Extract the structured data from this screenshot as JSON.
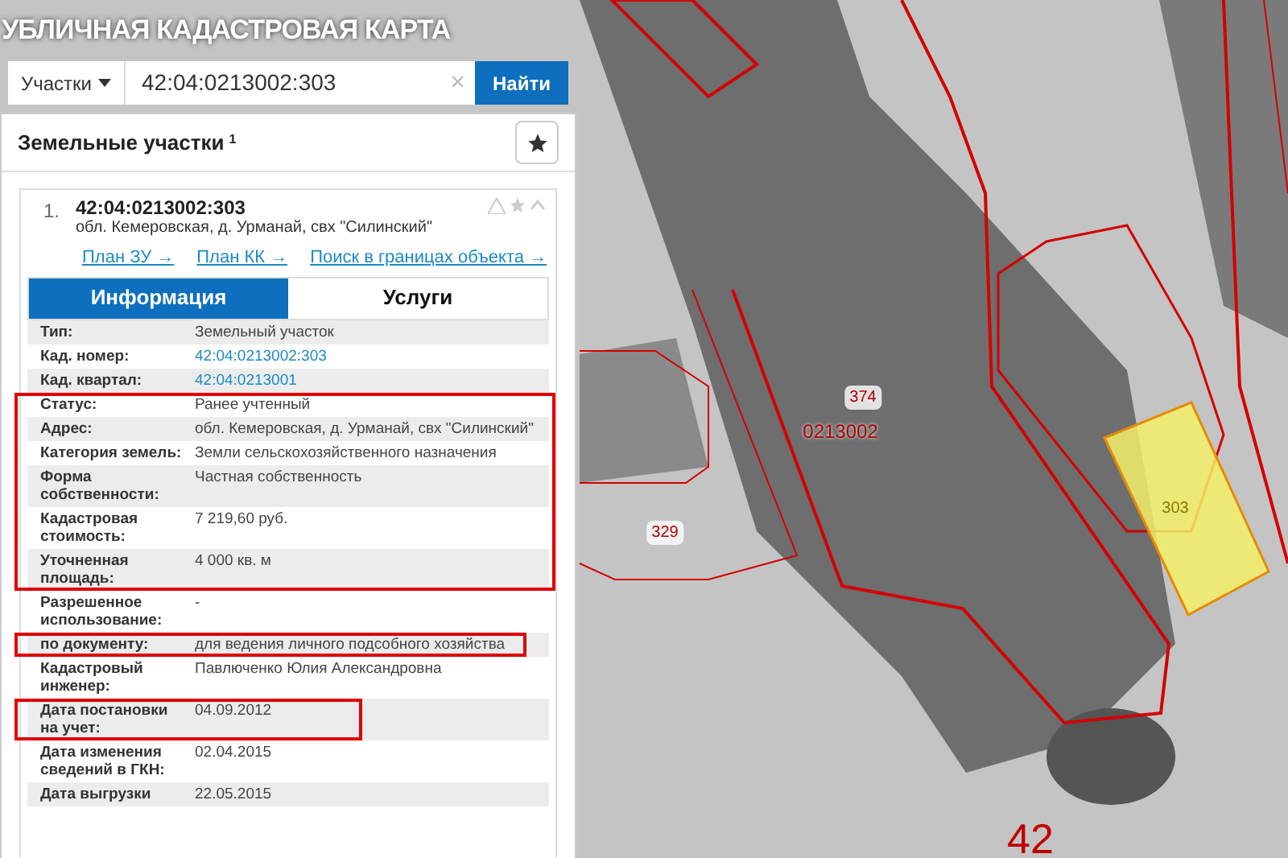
{
  "title": "УБЛИЧНАЯ КАДАСТРОВАЯ КАРТА",
  "search": {
    "category": "Участки",
    "value": "42:04:0213002:303",
    "clear": "×",
    "button": "Найти"
  },
  "results": {
    "heading": "Земельные участки",
    "count": "1",
    "item": {
      "index": "1.",
      "number": "42:04:0213002:303",
      "address": "обл. Кемеровская, д. Урманай, свх \"Силинский\"",
      "expanded": true,
      "links": [
        "План ЗУ →",
        "План КК →",
        "Поиск в границах объекта →"
      ],
      "tabs": [
        {
          "label": "Информация",
          "selected": true
        },
        {
          "label": "Услуги",
          "selected": false
        }
      ],
      "groups": [
        {
          "kind": "plain",
          "rows": [
            {
              "label": "Тип:",
              "value": "Земельный участок",
              "kind": "text"
            },
            {
              "label": "Кад. номер:",
              "value": "42:04:0213002:303",
              "kind": "link"
            },
            {
              "label": "Кад. квартал:",
              "value": "42:04:0213001",
              "kind": "link"
            }
          ]
        },
        {
          "kind": "box-wide",
          "rows": [
            {
              "label": "Статус:",
              "value": "Ранее учтенный",
              "kind": "text"
            },
            {
              "label": "Адрес:",
              "value": "обл. Кемеровская, д. Урманай, свх \"Силинский\"",
              "kind": "text"
            },
            {
              "label": "Категория земель:",
              "value": "Земли сельскохозяйственного назначения",
              "kind": "text"
            },
            {
              "label": "Форма собственности:",
              "value": "Частная собственность",
              "kind": "text"
            },
            {
              "label": "Кадастровая стоимость:",
              "value": "7 219,60 руб.",
              "kind": "text"
            },
            {
              "label": "Уточненная площадь:",
              "value": "4 000 кв. м",
              "kind": "text"
            }
          ]
        },
        {
          "kind": "plain",
          "rows": [
            {
              "label": "Разрешенное использование:",
              "value": "-",
              "kind": "text"
            }
          ]
        },
        {
          "kind": "box-medium",
          "rows": [
            {
              "label": "по документу:",
              "value": "для ведения личного подсобного хозяйства",
              "kind": "text"
            }
          ]
        },
        {
          "kind": "plain",
          "rows": [
            {
              "label": "Кадастровый инженер:",
              "value": "Павлюченко Юлия Александровна",
              "kind": "text"
            }
          ]
        },
        {
          "kind": "box-narrow",
          "rows": [
            {
              "label": "Дата постановки на учет:",
              "value": "04.09.2012",
              "kind": "text"
            }
          ]
        },
        {
          "kind": "plain",
          "rows": [
            {
              "label": "Дата изменения сведений в ГКН:",
              "value": "02.04.2015",
              "kind": "text"
            },
            {
              "label": "Дата выгрузки",
              "value": "22.05.2015",
              "kind": "text"
            }
          ]
        }
      ]
    }
  },
  "map": {
    "labels": [
      {
        "text": "374",
        "kind": "tag"
      },
      {
        "text": "0213002",
        "kind": "quarter"
      },
      {
        "text": "329",
        "kind": "tag"
      },
      {
        "text": "303",
        "kind": "selected"
      },
      {
        "text": "42",
        "kind": "big"
      }
    ]
  }
}
